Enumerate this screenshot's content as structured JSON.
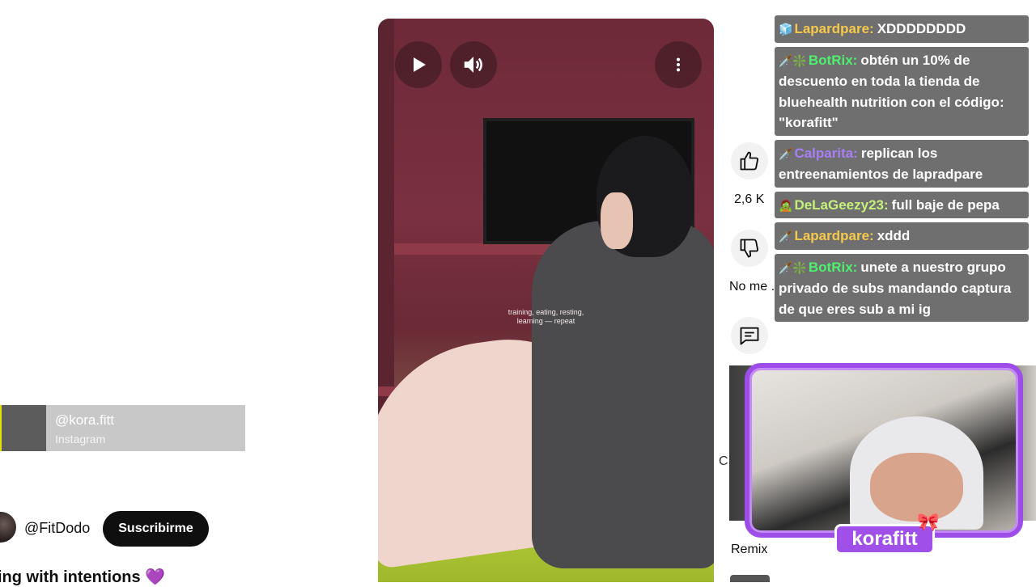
{
  "left_panel": {
    "overlay_card": {
      "handle": "@kora.fitt",
      "platform": "Instagram"
    },
    "channel": {
      "name": "@FitDodo",
      "subscribe_label": "Suscribirme"
    },
    "title": "ing with intentions",
    "title_emoji": "💜"
  },
  "video": {
    "caption_line1": "training, eating, resting,",
    "caption_line2": "learning — repeat"
  },
  "actions": {
    "like_count": "2,6 K",
    "dislike_label": "No me ...",
    "remix_label": "Remix",
    "partial_label": "C"
  },
  "chat": {
    "messages": [
      {
        "badge": "🧊",
        "user": "Lapardpare:",
        "text": "XDDDDDDDD"
      },
      {
        "badge": "🗡️❇️",
        "user": "BotRix:",
        "text": "obtén un 10% de descuento en toda la tienda de bluehealth nutrition con el código: \"korafitt\""
      },
      {
        "badge": "🗡️",
        "user": "Calparita:",
        "text": "replican los entreenamientos de lapradpare"
      },
      {
        "badge": "🧟",
        "user": "DeLaGeezy23:",
        "text": "full baje de pepa"
      },
      {
        "badge": "🗡️",
        "user": "Lapardpare:",
        "text": "xddd"
      },
      {
        "badge": "🗡️❇️",
        "user": "BotRix:",
        "text": "unete a nuestro grupo privado de subs mandando captura de que eres sub a mi ig"
      }
    ]
  },
  "facecam": {
    "streamer_name": "korafitt",
    "bow": "🎀"
  },
  "colors": {
    "chat_bg": "#6f6f6f",
    "facecam_border": "#9d4de8",
    "subscribe_bg": "#0f0f0f"
  }
}
